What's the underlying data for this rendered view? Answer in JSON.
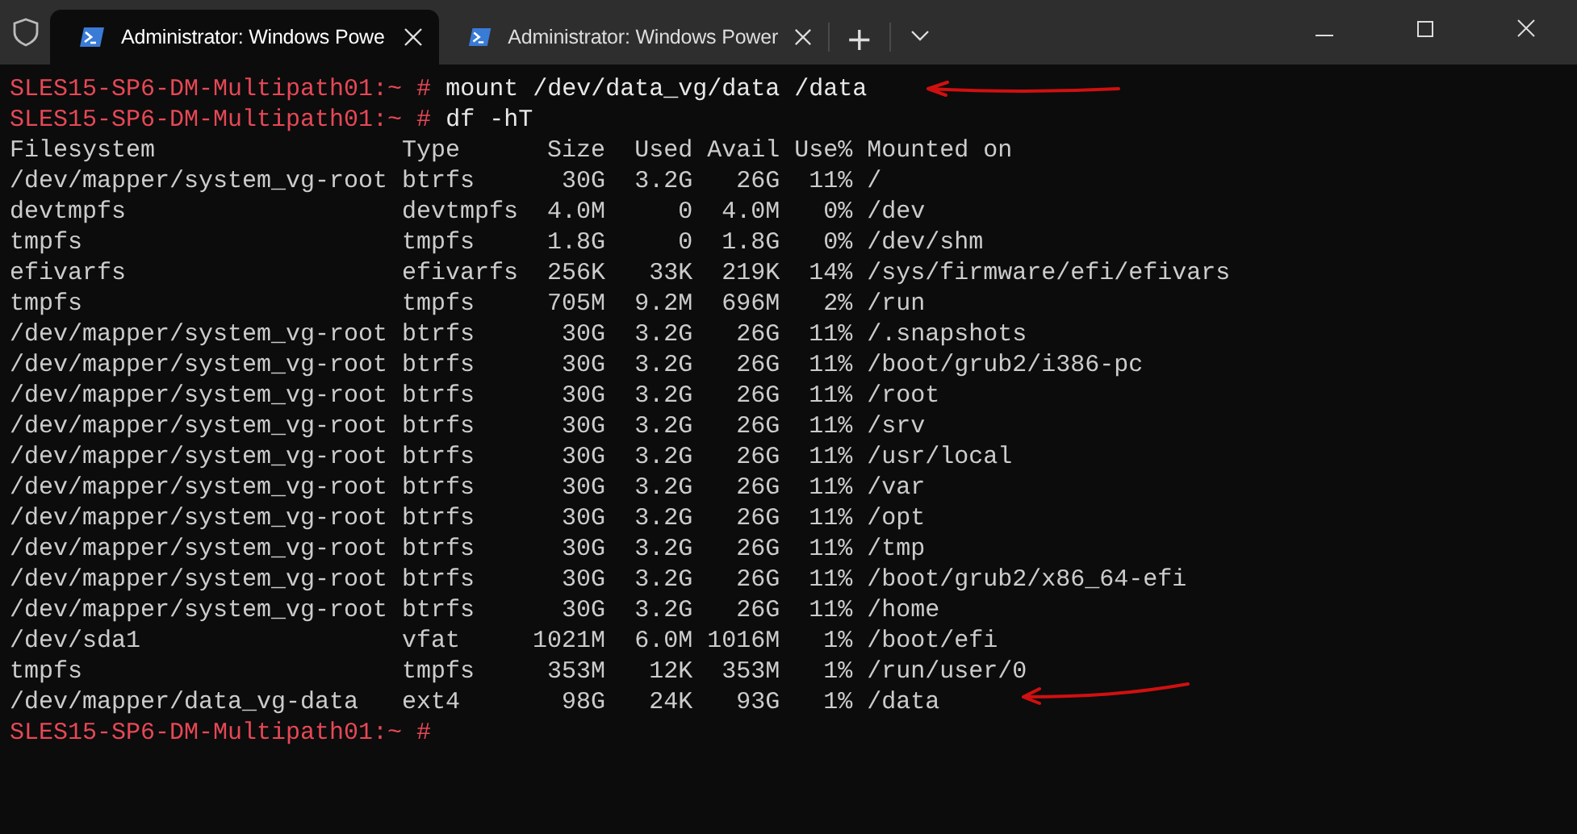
{
  "tabs": [
    {
      "title": "Administrator: Windows Powe",
      "selected": true
    },
    {
      "title": "Administrator: Windows Power",
      "selected": false
    }
  ],
  "new_tab": "+",
  "terminal": {
    "lines": [
      {
        "kind": "prompt",
        "prompt": "SLES15-SP6-DM-Multipath01:~ #",
        "command": "mount /dev/data_vg/data /data"
      },
      {
        "kind": "prompt",
        "prompt": "SLES15-SP6-DM-Multipath01:~ #",
        "command": "df -hT"
      },
      {
        "kind": "header",
        "cells": [
          "Filesystem",
          "Type",
          "Size",
          "Used",
          "Avail",
          "Use%",
          "Mounted on"
        ]
      },
      {
        "kind": "row",
        "cells": [
          "/dev/mapper/system_vg-root",
          "btrfs",
          "30G",
          "3.2G",
          "26G",
          "11%",
          "/"
        ]
      },
      {
        "kind": "row",
        "cells": [
          "devtmpfs",
          "devtmpfs",
          "4.0M",
          "0",
          "4.0M",
          "0%",
          "/dev"
        ]
      },
      {
        "kind": "row",
        "cells": [
          "tmpfs",
          "tmpfs",
          "1.8G",
          "0",
          "1.8G",
          "0%",
          "/dev/shm"
        ]
      },
      {
        "kind": "row",
        "cells": [
          "efivarfs",
          "efivarfs",
          "256K",
          "33K",
          "219K",
          "14%",
          "/sys/firmware/efi/efivars"
        ]
      },
      {
        "kind": "row",
        "cells": [
          "tmpfs",
          "tmpfs",
          "705M",
          "9.2M",
          "696M",
          "2%",
          "/run"
        ]
      },
      {
        "kind": "row",
        "cells": [
          "/dev/mapper/system_vg-root",
          "btrfs",
          "30G",
          "3.2G",
          "26G",
          "11%",
          "/.snapshots"
        ]
      },
      {
        "kind": "row",
        "cells": [
          "/dev/mapper/system_vg-root",
          "btrfs",
          "30G",
          "3.2G",
          "26G",
          "11%",
          "/boot/grub2/i386-pc"
        ]
      },
      {
        "kind": "row",
        "cells": [
          "/dev/mapper/system_vg-root",
          "btrfs",
          "30G",
          "3.2G",
          "26G",
          "11%",
          "/root"
        ]
      },
      {
        "kind": "row",
        "cells": [
          "/dev/mapper/system_vg-root",
          "btrfs",
          "30G",
          "3.2G",
          "26G",
          "11%",
          "/srv"
        ]
      },
      {
        "kind": "row",
        "cells": [
          "/dev/mapper/system_vg-root",
          "btrfs",
          "30G",
          "3.2G",
          "26G",
          "11%",
          "/usr/local"
        ]
      },
      {
        "kind": "row",
        "cells": [
          "/dev/mapper/system_vg-root",
          "btrfs",
          "30G",
          "3.2G",
          "26G",
          "11%",
          "/var"
        ]
      },
      {
        "kind": "row",
        "cells": [
          "/dev/mapper/system_vg-root",
          "btrfs",
          "30G",
          "3.2G",
          "26G",
          "11%",
          "/opt"
        ]
      },
      {
        "kind": "row",
        "cells": [
          "/dev/mapper/system_vg-root",
          "btrfs",
          "30G",
          "3.2G",
          "26G",
          "11%",
          "/tmp"
        ]
      },
      {
        "kind": "row",
        "cells": [
          "/dev/mapper/system_vg-root",
          "btrfs",
          "30G",
          "3.2G",
          "26G",
          "11%",
          "/boot/grub2/x86_64-efi"
        ]
      },
      {
        "kind": "row",
        "cells": [
          "/dev/mapper/system_vg-root",
          "btrfs",
          "30G",
          "3.2G",
          "26G",
          "11%",
          "/home"
        ]
      },
      {
        "kind": "row",
        "cells": [
          "/dev/sda1",
          "vfat",
          "1021M",
          "6.0M",
          "1016M",
          "1%",
          "/boot/efi"
        ]
      },
      {
        "kind": "row",
        "cells": [
          "tmpfs",
          "tmpfs",
          "353M",
          "12K",
          "353M",
          "1%",
          "/run/user/0"
        ]
      },
      {
        "kind": "row",
        "cells": [
          "/dev/mapper/data_vg-data",
          "ext4",
          "98G",
          "24K",
          "93G",
          "1%",
          "/data"
        ]
      },
      {
        "kind": "prompt",
        "prompt": "SLES15-SP6-DM-Multipath01:~ #"
      }
    ]
  }
}
